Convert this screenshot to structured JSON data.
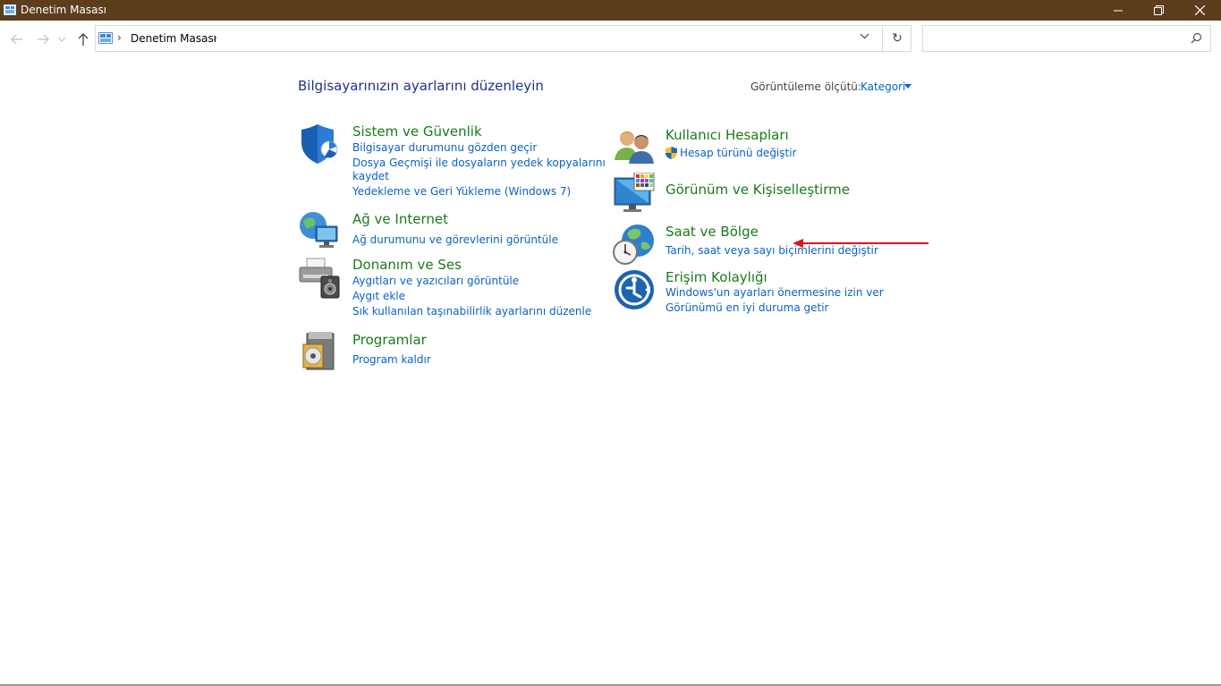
{
  "window": {
    "title": "Denetim Masası"
  },
  "navigation": {
    "breadcrumb": [
      "Denetim Masası"
    ],
    "search_placeholder": ""
  },
  "header": {
    "page_title": "Bilgisayarınızın ayarlarını düzenleyin",
    "view_by_label": "Görüntüleme ölçütü:",
    "view_by_value": "Kategori"
  },
  "categories_left": [
    {
      "title": "Sistem ve Güvenlik",
      "icon": "shield-icon",
      "links": [
        "Bilgisayar durumunu gözden geçir",
        "Dosya Geçmişi ile dosyaların yedek kopyalarını",
        "kaydet",
        "Yedekleme ve Geri Yükleme (Windows 7)"
      ]
    },
    {
      "title": "Ağ ve Internet",
      "icon": "network-globe-icon",
      "links": [
        "Ağ durumunu ve görevlerini görüntüle"
      ]
    },
    {
      "title": "Donanım ve Ses",
      "icon": "printer-speaker-icon",
      "links": [
        "Aygıtları ve yazıcıları görüntüle",
        "Aygıt ekle",
        "Sık kullanılan taşınabilirlik ayarlarını düzenle"
      ]
    },
    {
      "title": "Programlar",
      "icon": "programs-disc-icon",
      "links": [
        "Program kaldır"
      ]
    }
  ],
  "categories_right": [
    {
      "title": "Kullanıcı Hesapları",
      "icon": "users-icon",
      "links": [
        "Hesap türünü değiştir"
      ]
    },
    {
      "title": "Görünüm ve Kişiselleştirme",
      "icon": "monitor-palette-icon",
      "links": []
    },
    {
      "title": "Saat ve Bölge",
      "icon": "clock-globe-icon",
      "links": [
        "Tarih, saat veya sayı biçimlerini değiştir"
      ]
    },
    {
      "title": "Erişim Kolaylığı",
      "icon": "accessibility-icon",
      "links": [
        "Windows'un ayarları önermesine izin ver",
        "Görünümü en iyi duruma getir"
      ]
    }
  ],
  "colors": {
    "titlebar": "#5c3d1c",
    "category_title": "#1a7a1a",
    "link": "#0b62c4",
    "annotation_arrow": "#e01020"
  }
}
